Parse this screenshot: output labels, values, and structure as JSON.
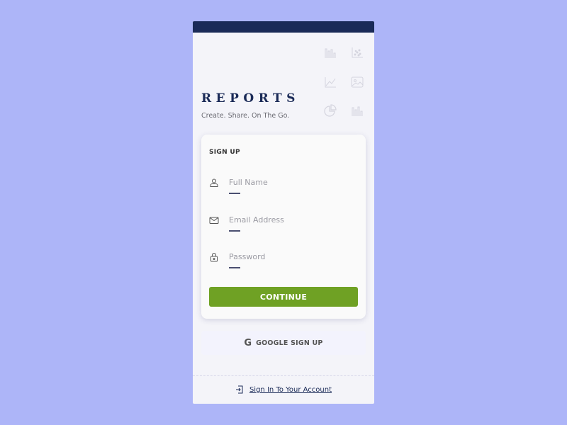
{
  "app": {
    "title": "REPORTS",
    "tagline": "Create. Share. On The Go."
  },
  "decorative_icons": [
    "bar-chart-icon",
    "scatter-chart-icon",
    "line-chart-icon",
    "image-icon",
    "pie-chart-icon",
    "bar-chart-icon"
  ],
  "form": {
    "title": "SIGN UP",
    "fields": [
      {
        "icon": "user-icon",
        "placeholder": "Full Name",
        "value": ""
      },
      {
        "icon": "mail-icon",
        "placeholder": "Email Address",
        "value": ""
      },
      {
        "icon": "lock-icon",
        "placeholder": "Password",
        "value": ""
      }
    ],
    "submit_label": "CONTINUE"
  },
  "google": {
    "icon": "google-icon",
    "glyph": "G",
    "label": "GOOGLE SIGN UP"
  },
  "footer": {
    "icon": "sign-in-icon",
    "link_label": "Sign In To Your Account"
  },
  "colors": {
    "background": "#adb5f8",
    "header": "#1a2a57",
    "accent": "#6fa124",
    "panel": "#f4f4f9"
  }
}
